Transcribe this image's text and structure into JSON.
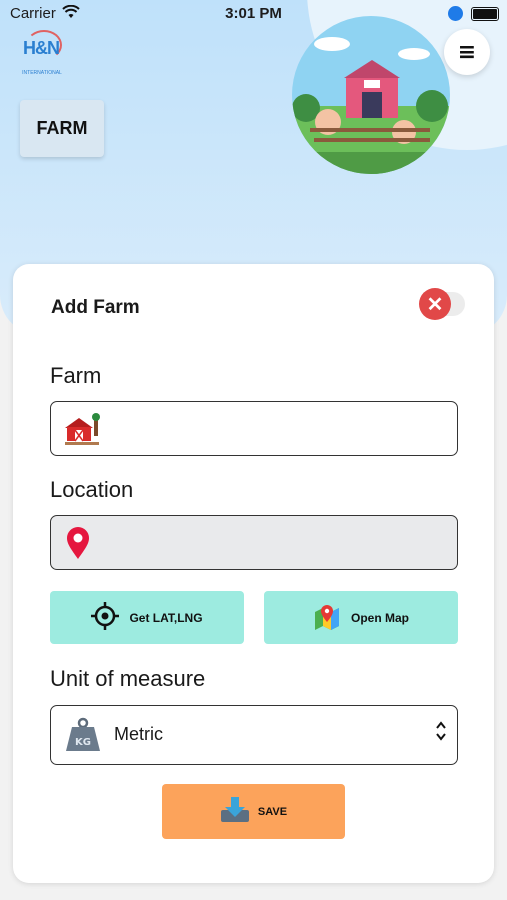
{
  "status_bar": {
    "carrier": "Carrier",
    "time": "3:01 PM"
  },
  "brand": {
    "logo_text": "H&N",
    "logo_subtext": "INTERNATIONAL"
  },
  "header": {
    "tab_label": "FARM"
  },
  "form": {
    "title": "Add Farm",
    "farm_label": "Farm",
    "farm_value": "",
    "location_label": "Location",
    "location_value": "",
    "get_latlng_label": "Get LAT,LNG",
    "open_map_label": "Open Map",
    "unit_label": "Unit of measure",
    "unit_value": "Metric",
    "save_label": "SAVE"
  },
  "colors": {
    "hero_bg": "#bfe1fa",
    "teal_button": "#9debe0",
    "save_button": "#fca35b",
    "close_red": "#e14848"
  },
  "icons": [
    "wifi-icon",
    "location-arrow-icon",
    "battery-icon",
    "menu-icon",
    "close-icon",
    "barn-icon",
    "map-pin-icon",
    "crosshair-icon",
    "map-icon",
    "weight-icon",
    "chevron-updown-icon",
    "download-icon"
  ]
}
